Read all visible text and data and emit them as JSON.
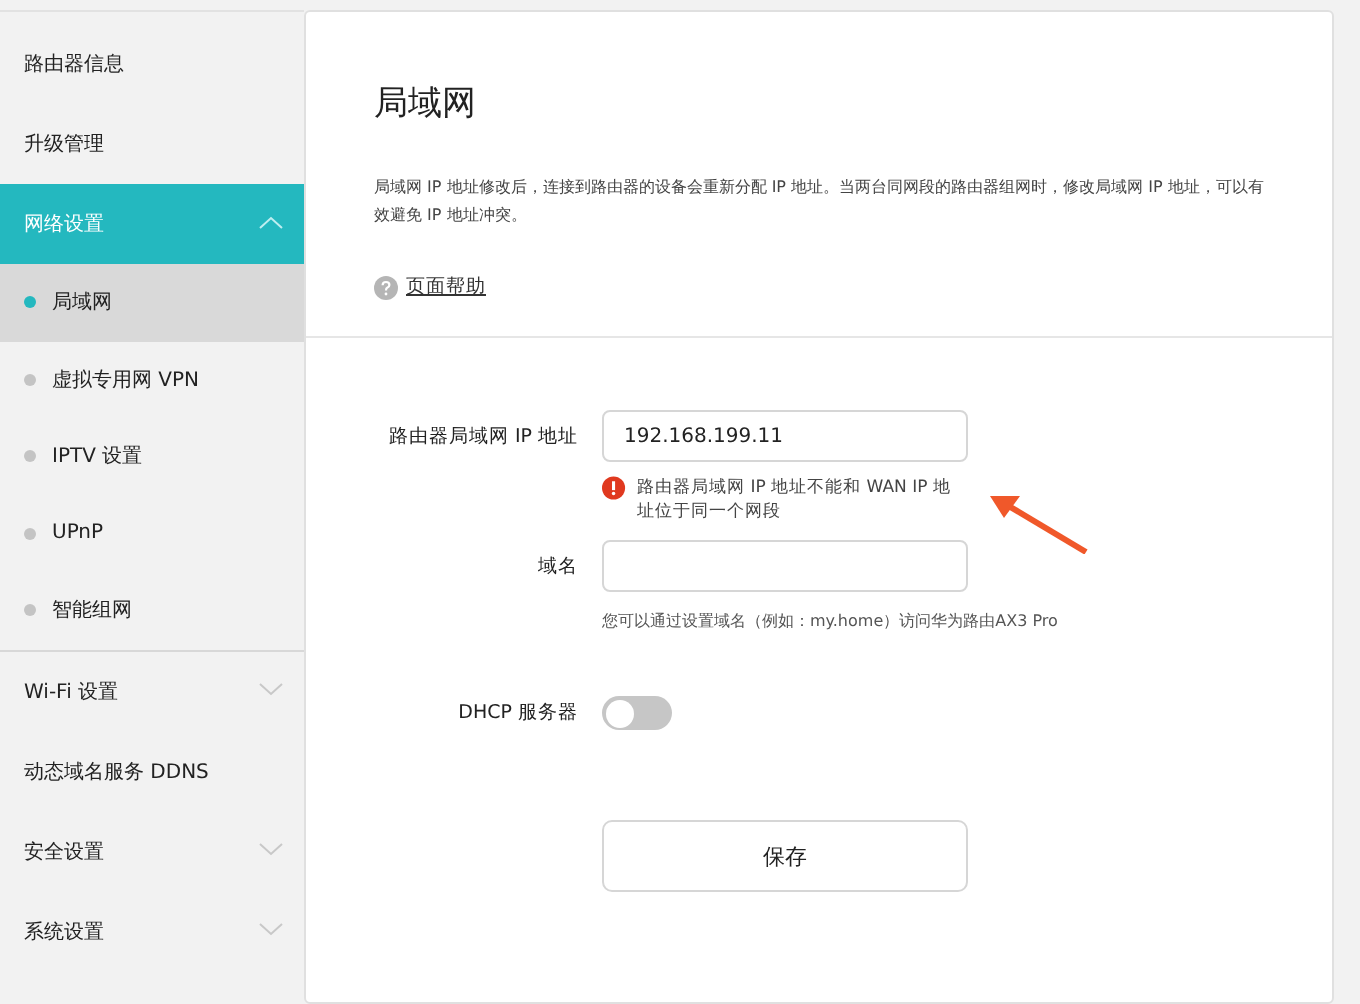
{
  "sidebar": {
    "items": [
      {
        "label": "路由器信息",
        "kind": "link",
        "selected": false
      },
      {
        "label": "升级管理",
        "kind": "link",
        "selected": false
      },
      {
        "label": "网络设置",
        "kind": "group",
        "expanded": true,
        "selected": true,
        "children": [
          {
            "label": "局域网",
            "selected": true
          },
          {
            "label": "虚拟专用网 VPN",
            "selected": false
          },
          {
            "label": "IPTV 设置",
            "selected": false
          },
          {
            "label": "UPnP",
            "selected": false
          },
          {
            "label": "智能组网",
            "selected": false
          }
        ]
      },
      {
        "label": "Wi-Fi 设置",
        "kind": "group",
        "expanded": false,
        "selected": false
      },
      {
        "label": "动态域名服务 DDNS",
        "kind": "link",
        "selected": false
      },
      {
        "label": "安全设置",
        "kind": "group",
        "expanded": false,
        "selected": false
      },
      {
        "label": "系统设置",
        "kind": "group",
        "expanded": false,
        "selected": false
      }
    ]
  },
  "page": {
    "title": "局域网",
    "description": "局域网 IP 地址修改后，连接到路由器的设备会重新分配 IP 地址。当两台同网段的路由器组网时，修改局域网 IP 地址，可以有效避免 IP 地址冲突。",
    "help_link": "页面帮助"
  },
  "form": {
    "fields": [
      {
        "kind": "input",
        "label": "路由器局域网 IP 地址",
        "value": "192.168.199.11",
        "error": "路由器局域网 IP 地址不能和 WAN IP 地址位于同一个网段"
      },
      {
        "kind": "input",
        "label": "域名",
        "hint": "您可以通过设置域名（例如：my.home）访问华为路由AX3 Pro"
      },
      {
        "kind": "toggle",
        "label": "DHCP 服务器",
        "on": false
      }
    ],
    "save_button": "保存"
  }
}
